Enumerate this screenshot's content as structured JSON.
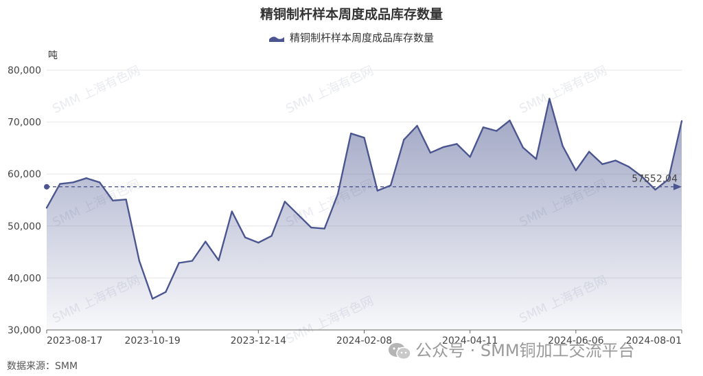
{
  "chart_data": {
    "type": "area",
    "title": "精铜制杆样本周度成品库存数量",
    "ylabel": "吨",
    "ylim": [
      30000,
      80000
    ],
    "yticks": [
      30000,
      40000,
      50000,
      60000,
      70000,
      80000
    ],
    "ytick_labels": [
      "30,000",
      "40,000",
      "50,000",
      "60,000",
      "70,000",
      "80,000"
    ],
    "xtick_labels": [
      {
        "index": 0,
        "label": "2023-08-17"
      },
      {
        "index": 8,
        "label": "2023-10-19"
      },
      {
        "index": 16,
        "label": "2023-12-14"
      },
      {
        "index": 24,
        "label": "2024-02-08"
      },
      {
        "index": 32,
        "label": "2024-04-11"
      },
      {
        "index": 40,
        "label": "2024-06-06"
      },
      {
        "index": 48,
        "label": "2024-08-01"
      }
    ],
    "grid": true,
    "legend": "top-center",
    "series": [
      {
        "name": "精铜制杆样本周度成品库存数量",
        "color": "#4b5690",
        "values": [
          53500,
          58100,
          58400,
          59200,
          58400,
          54900,
          55100,
          43300,
          36000,
          37300,
          42900,
          43300,
          47000,
          43400,
          52800,
          47800,
          46800,
          48100,
          54700,
          52200,
          49700,
          49500,
          56100,
          67800,
          67000,
          56800,
          57800,
          66600,
          69300,
          64100,
          65200,
          65800,
          63300,
          69000,
          68300,
          70300,
          65100,
          62900,
          74500,
          65400,
          60700,
          64300,
          61900,
          62600,
          61400,
          59500,
          57000,
          59000,
          70200
        ]
      }
    ],
    "average_line": {
      "value": 57552.04,
      "label": "57552.04"
    },
    "watermark": "SMM 上海有色网"
  },
  "labels": {
    "source": "数据来源：SMM",
    "wechat": "公众号 · SMM铜加工交流平台"
  }
}
